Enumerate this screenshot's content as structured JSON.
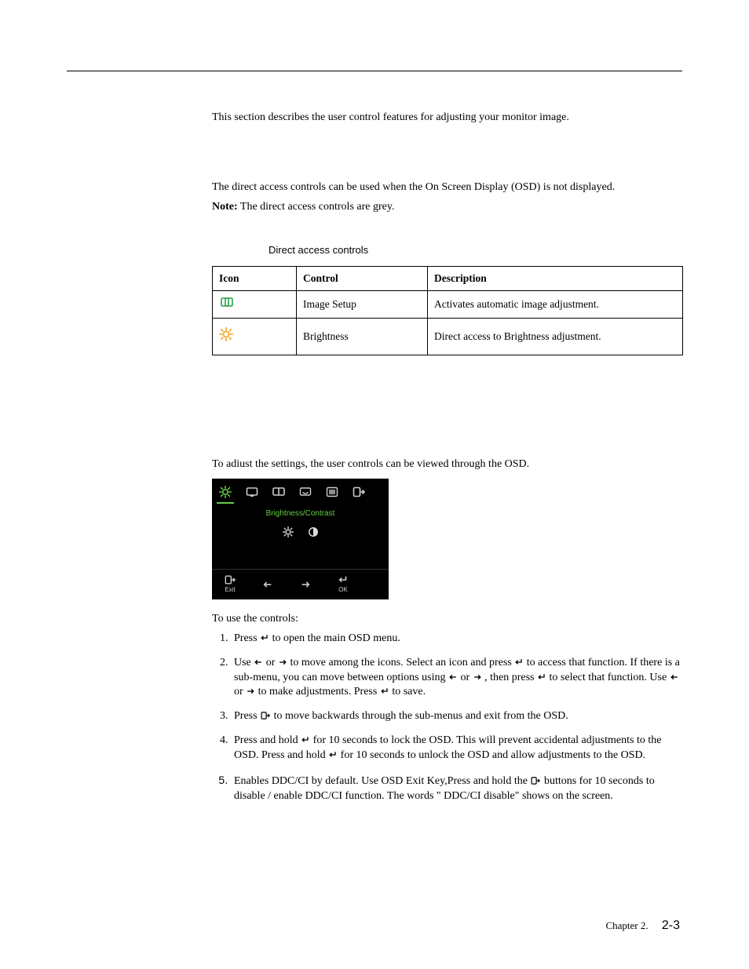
{
  "intro": "This section describes the user control features for adjusting your monitor image.",
  "direct_access": {
    "p1": "The direct access controls can be used when the On Screen Display (OSD) is not displayed.",
    "note_label": "Note:",
    "note_text": " The direct access controls are grey.",
    "caption": "Direct access controls",
    "headers": {
      "icon": "Icon",
      "control": "Control",
      "description": "Description"
    },
    "rows": [
      {
        "icon": "image-setup-icon",
        "control": "Image Setup",
        "description": "Activates automatic image adjustment."
      },
      {
        "icon": "brightness-icon",
        "control": "Brightness",
        "description": "Direct access to Brightness adjustment."
      }
    ]
  },
  "osd_section": {
    "lead": "To adiust the settings, the user controls can be viewed through the OSD.",
    "osd_title": "Brightness/Contrast",
    "osd_exit": "Exit",
    "osd_ok": "OK",
    "after": "To use the controls:"
  },
  "steps": {
    "s1_a": "Press ",
    "s1_b": " to open the main OSD menu.",
    "s2_a": "Use ",
    "s2_b": " or ",
    "s2_c": " to move among the icons. Select an icon and press  ",
    "s2_d": " to access that function. If there is a sub-menu, you can move between options using ",
    "s2_e": " or ",
    "s2_f": " , then press  ",
    "s2_g": " to select that function. Use ",
    "s2_h": " or ",
    "s2_i": " to make adjustments. Press ",
    "s2_j": "  to save.",
    "s3_a": "Press ",
    "s3_b": "   to move backwards through the sub-menus and exit from the OSD.",
    "s4_a": "Press and hold  ",
    "s4_b": "  for 10 seconds to lock the OSD. This will prevent accidental adjustments to the OSD. Press and hold ",
    "s4_c": "  for 10  seconds to unlock the OSD and allow adjustments to the OSD.",
    "s5_a": "Enables DDC/CI by default. Use OSD Exit Key,Press and hold the  ",
    "s5_b": "  buttons  for 10 seconds to disable / enable DDC/CI function. The words \" DDC/CI disable\" shows on the screen."
  },
  "footer": {
    "chapter": "Chapter 2.",
    "page": "2-3"
  }
}
